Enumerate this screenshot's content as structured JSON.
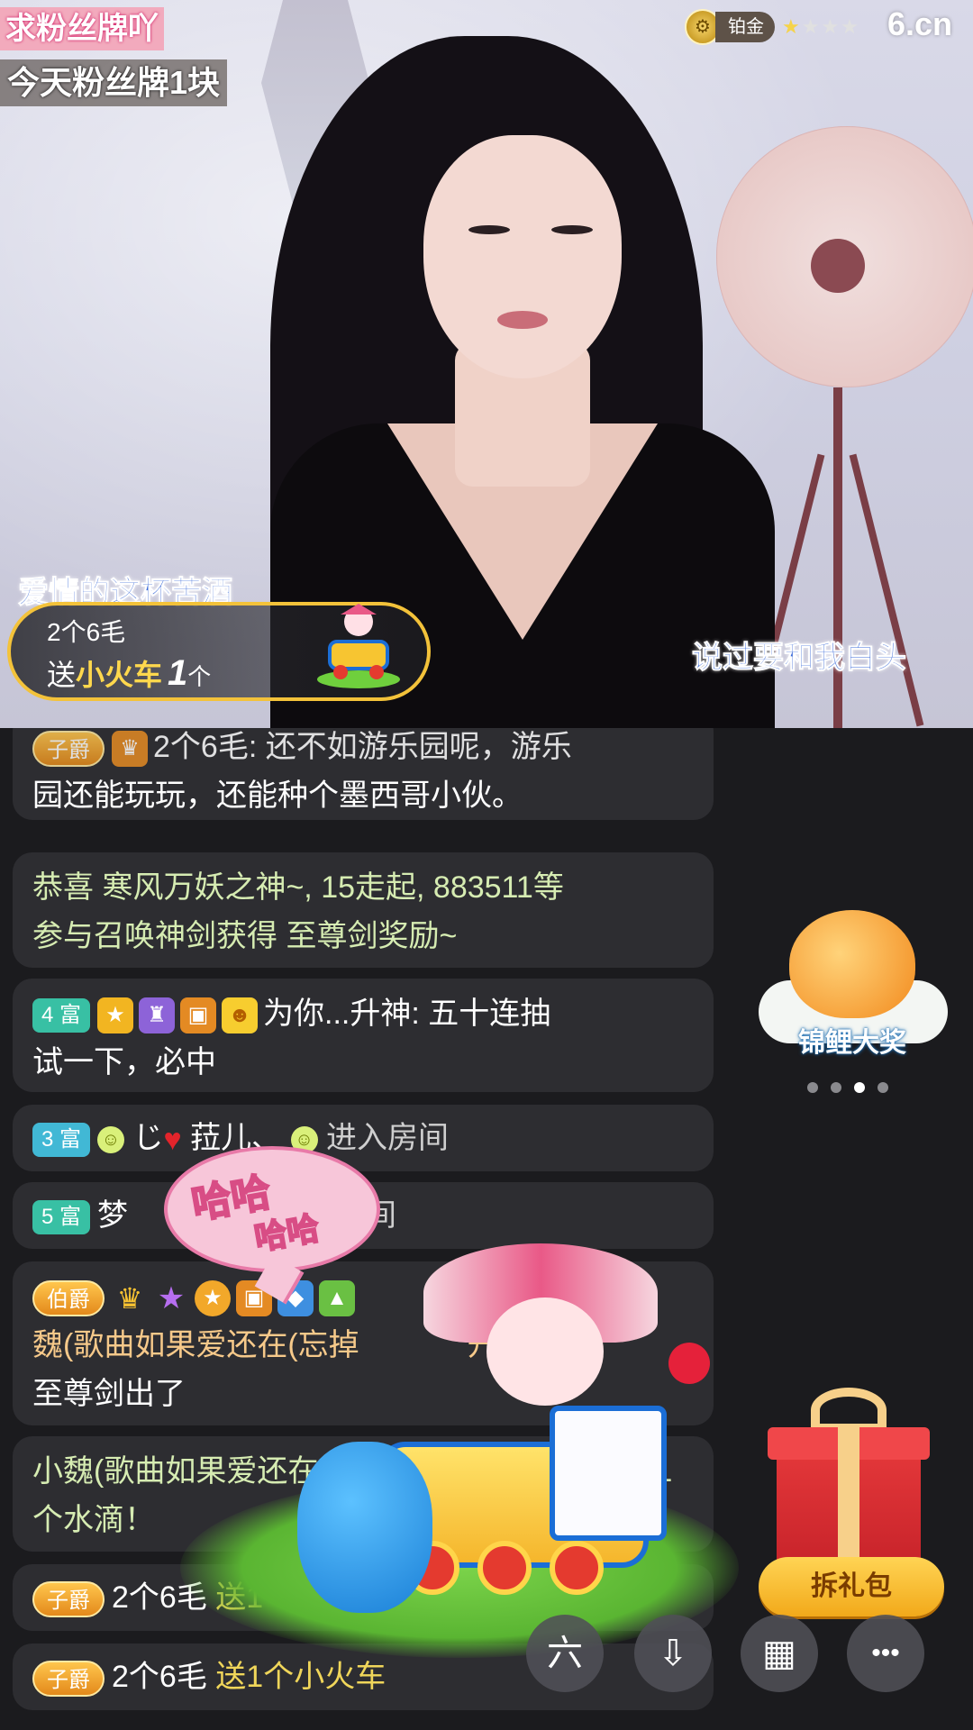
{
  "stream": {
    "overlay_top": "求粉丝牌吖",
    "overlay_sub": "今天粉丝牌1块",
    "rank_label": "铂金",
    "rank_stars": "★",
    "rank_stars_off": "★★★",
    "site_logo": "6.cn",
    "lyric_left": "爱情的这杯苦酒",
    "lyric_right": "说过要和我白头"
  },
  "gift_banner": {
    "user": "2个6毛",
    "verb": "送",
    "gift_name": "小火车",
    "count": "1",
    "unit": "个"
  },
  "chat": [
    {
      "badge": "子爵",
      "text_partial": "2个6毛: 还不如游乐园呢，游乐",
      "text": "园还能玩玩，还能种个墨西哥小伙。"
    },
    {
      "line1": "恭喜 寒风万妖之神~, 15走起, 883511等",
      "line2": "参与召唤神剑获得 至尊剑奖励~"
    },
    {
      "level": "4 富",
      "text1": "为你...升神: 五十连抽",
      "text2": "试一下，必中"
    },
    {
      "level": "3 富",
      "user_a": "じ",
      "user_b": "菈儿、",
      "action": "进入房间"
    },
    {
      "level": "5 富",
      "user": "梦",
      "action": "入房间"
    },
    {
      "badge": "伯爵",
      "user": "魏(歌曲如果爱还在(忘掉",
      "user_tail": "开始):",
      "text": "至尊剑出了"
    },
    {
      "line1": "小魏(歌曲如果爱还在",
      "line1_tail": "了1",
      "line2": "个水滴！"
    },
    {
      "badge": "子爵",
      "user": "2个6毛",
      "action": "送1"
    },
    {
      "badge": "子爵",
      "user": "2个6毛",
      "action": "送1个小火车"
    }
  ],
  "widgets": {
    "koi_label": "锦鲤大奖",
    "open_pack": "拆礼包"
  },
  "animation": {
    "speech_1": "哈哈",
    "speech_2": "哈哈"
  },
  "toolbar": {
    "share_icon": "六",
    "download_icon": "⇩",
    "grid_icon": "▦",
    "more_icon": "•••"
  },
  "colors": {
    "accent_gold": "#f3c23a",
    "chat_bg": "#1b1b1e",
    "bubble_bg": "#2d2d31",
    "system_text": "#d6ecb2",
    "lyric_blue": "#3a6ad8"
  }
}
